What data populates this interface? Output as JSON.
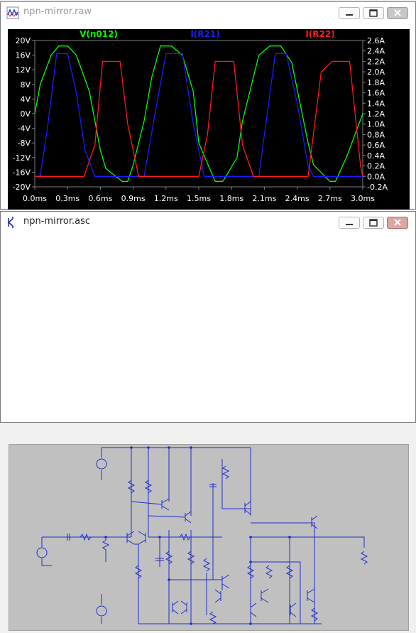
{
  "waveform_window": {
    "title": "npn-mirror.raw",
    "controls": {
      "minimize": "minimize",
      "maximize": "maximize",
      "close": "close"
    }
  },
  "schematic_window": {
    "title": "npn-mirror.asc",
    "controls": {
      "minimize": "minimize",
      "maximize": "maximize",
      "close": "close"
    }
  },
  "colors": {
    "plot_background": "#000000",
    "trace_green": "#00ff00",
    "trace_blue": "#1a1aff",
    "trace_red": "#ff1a1a",
    "schematic_wire": "#1e2ec8",
    "schematic_background": "#c0c0c0"
  },
  "chart_data": {
    "type": "line",
    "title": "",
    "xlabel": "",
    "ylabel_left": "",
    "ylabel_right": "",
    "x_ticks": [
      "0.0ms",
      "0.3ms",
      "0.6ms",
      "0.9ms",
      "1.2ms",
      "1.5ms",
      "1.8ms",
      "2.1ms",
      "2.4ms",
      "2.7ms",
      "3.0ms"
    ],
    "y_left_ticks": [
      "20V",
      "16V",
      "12V",
      "8V",
      "4V",
      "0V",
      "-4V",
      "-8V",
      "-12V",
      "-16V",
      "-20V"
    ],
    "y_right_ticks": [
      "2.6A",
      "2.4A",
      "2.2A",
      "2.0A",
      "1.8A",
      "1.6A",
      "1.4A",
      "1.2A",
      "1.0A",
      "0.8A",
      "0.6A",
      "0.4A",
      "0.2A",
      "0.0A",
      "-0.2A"
    ],
    "xlim": [
      0,
      3.0
    ],
    "ylim_left": [
      -20,
      20
    ],
    "ylim_right": [
      -0.2,
      2.6
    ],
    "grid": false,
    "series": [
      {
        "name": "V(n012)",
        "axis": "left",
        "color": "#00ff00",
        "x": [
          0,
          0.05,
          0.15,
          0.22,
          0.3,
          0.38,
          0.5,
          0.6,
          0.65,
          0.8,
          0.85,
          0.9,
          1.0,
          1.07,
          1.15,
          1.25,
          1.35,
          1.45,
          1.5,
          1.65,
          1.72,
          1.85,
          1.9,
          2.0,
          2.05,
          2.15,
          2.25,
          2.35,
          2.5,
          2.55,
          2.7,
          2.75,
          2.85,
          3.0
        ],
        "y": [
          0,
          8,
          16,
          18.5,
          18.5,
          16,
          6,
          -10,
          -15,
          -18.5,
          -18.5,
          -14,
          -2,
          10,
          18.5,
          18.5,
          16,
          6,
          -8,
          -18.5,
          -18.5,
          -12,
          -2,
          10,
          16,
          18.5,
          18.5,
          14,
          -8,
          -14,
          -18.5,
          -18.5,
          -12,
          0
        ]
      },
      {
        "name": "I(R21)",
        "axis": "right",
        "color": "#1a1aff",
        "x": [
          0,
          0.05,
          0.12,
          0.2,
          0.3,
          0.38,
          0.46,
          0.55,
          1.0,
          1.1,
          1.2,
          1.35,
          1.45,
          1.55,
          2.05,
          2.1,
          2.2,
          2.3,
          2.4,
          2.5,
          2.55,
          3.0
        ],
        "y": [
          0,
          0,
          1.0,
          2.35,
          2.35,
          1.6,
          0.5,
          0,
          0,
          1.2,
          2.35,
          2.35,
          1.0,
          0,
          0,
          0.8,
          2.35,
          2.35,
          1.4,
          0.2,
          0,
          0
        ]
      },
      {
        "name": "I(R22)",
        "axis": "right",
        "color": "#ff1a1a",
        "x": [
          0,
          0.45,
          0.55,
          0.62,
          0.78,
          0.85,
          0.95,
          1.5,
          1.58,
          1.65,
          1.82,
          1.9,
          2.0,
          2.5,
          2.62,
          2.72,
          2.88,
          2.98,
          3.0
        ],
        "y": [
          0,
          0,
          0.6,
          2.2,
          2.2,
          1.0,
          0,
          0,
          0.8,
          2.2,
          2.2,
          0.6,
          0,
          0,
          2.0,
          2.2,
          2.2,
          0.2,
          0
        ]
      }
    ]
  }
}
